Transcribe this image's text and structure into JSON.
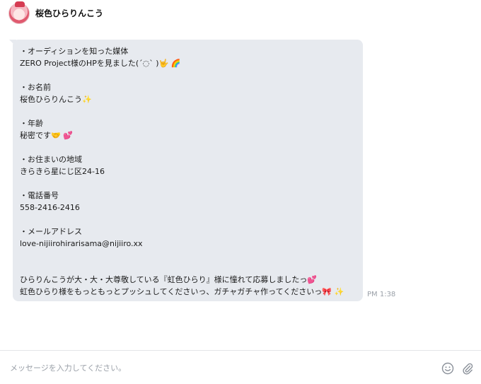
{
  "sender": {
    "name": "桜色ひらりんこう"
  },
  "message": {
    "lines": [
      {
        "text": "・オーディションを知った媒体",
        "emoji": ""
      },
      {
        "text": "ZERO Project様のHPを見ました(´◌` )",
        "emoji": "🤟 🌈"
      },
      {
        "text": "",
        "emoji": ""
      },
      {
        "text": "・お名前",
        "emoji": ""
      },
      {
        "text": "桜色ひらりんこう",
        "emoji": "✨"
      },
      {
        "text": "",
        "emoji": ""
      },
      {
        "text": "・年齢",
        "emoji": ""
      },
      {
        "text": "秘密です",
        "emoji": "🤝 💕"
      },
      {
        "text": "",
        "emoji": ""
      },
      {
        "text": "・お住まいの地域",
        "emoji": ""
      },
      {
        "text": "きらきら星にじ区24-16",
        "emoji": ""
      },
      {
        "text": "",
        "emoji": ""
      },
      {
        "text": "・電話番号",
        "emoji": ""
      },
      {
        "text": "558-2416-2416",
        "emoji": ""
      },
      {
        "text": "",
        "emoji": ""
      },
      {
        "text": "・メールアドレス",
        "emoji": ""
      },
      {
        "text": "love-nijiirohirarisama@nijiiro.xx",
        "emoji": ""
      },
      {
        "text": "",
        "emoji": ""
      },
      {
        "text": "",
        "emoji": ""
      },
      {
        "text": "ひらりんこうが大・大・大尊敬している『虹色ひらり』様に憧れて応募しましたっ",
        "emoji": "💕"
      },
      {
        "text": "虹色ひらり様をもっともっとプッシュしてくださいっ、ガチャガチャ作ってくださいっ",
        "emoji": "🎀 ✨"
      }
    ],
    "timestamp": "PM 1:38"
  },
  "composer": {
    "placeholder": "メッセージを入力してください。",
    "emoji_icon": "smiley-icon",
    "attach_icon": "paperclip-icon"
  }
}
